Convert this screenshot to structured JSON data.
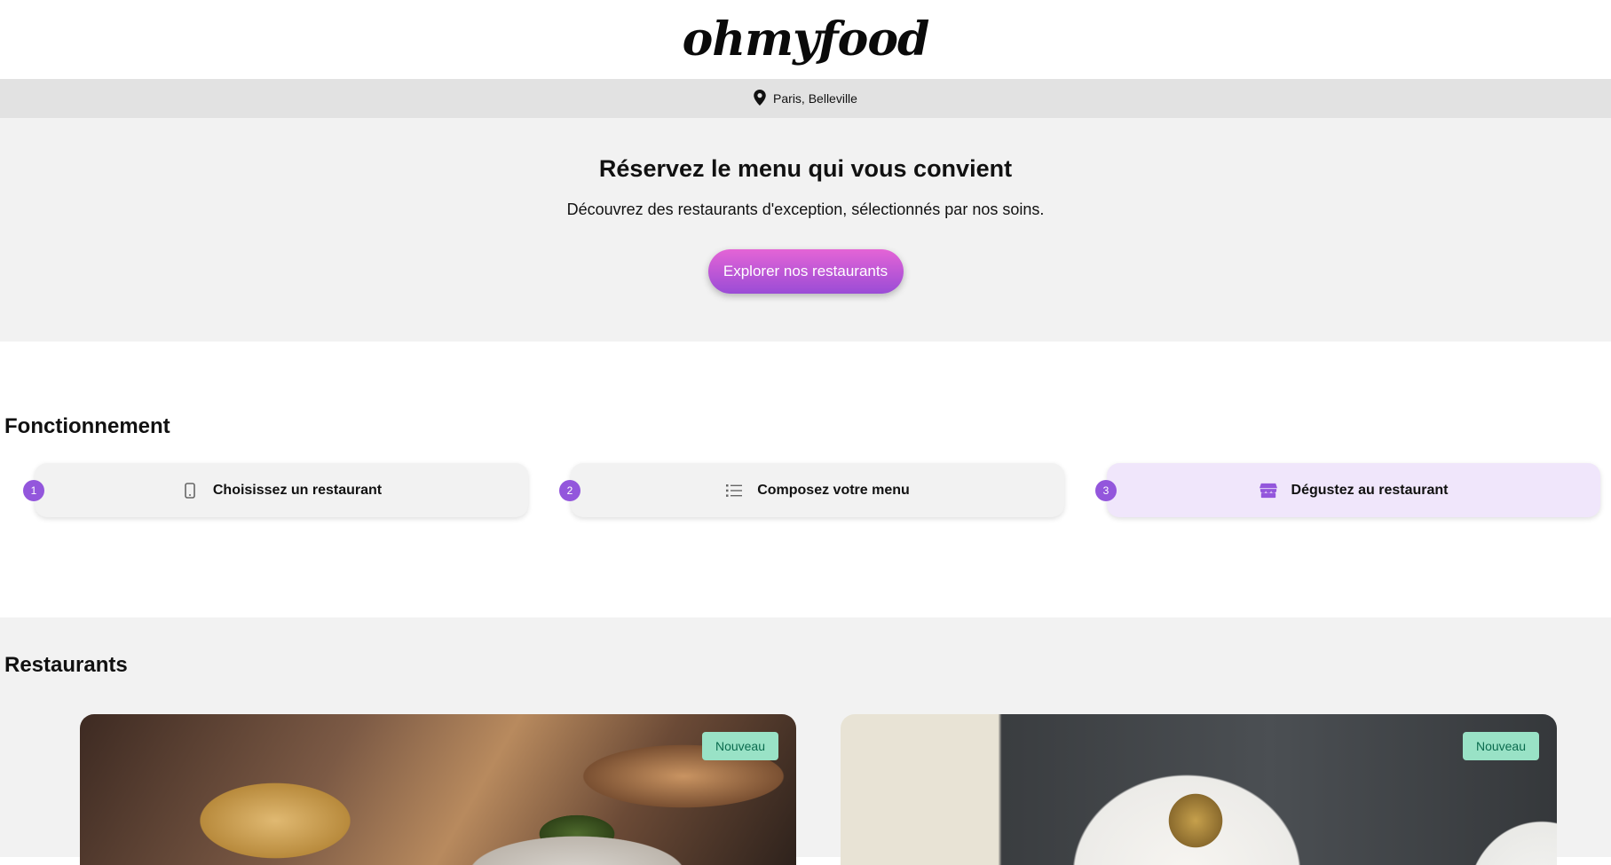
{
  "header": {
    "logo": "ohmyfood"
  },
  "location": {
    "icon": "map-pin-icon",
    "text": "Paris, Belleville"
  },
  "hero": {
    "title": "Réservez le menu qui vous convient",
    "subtitle": "Découvrez des restaurants d'exception, sélectionnés par nos soins.",
    "cta_label": "Explorer nos restaurants"
  },
  "how": {
    "title": "Fonctionnement",
    "steps": [
      {
        "num": "1",
        "label": "Choisissez un restaurant",
        "icon": "mobile-phone-icon"
      },
      {
        "num": "2",
        "label": "Composez votre menu",
        "icon": "list-icon"
      },
      {
        "num": "3",
        "label": "Dégustez au restaurant",
        "icon": "store-icon"
      }
    ]
  },
  "restaurants": {
    "title": "Restaurants",
    "cards": [
      {
        "badge": "Nouveau"
      },
      {
        "badge": "Nouveau"
      }
    ]
  },
  "colors": {
    "accent": "#9356dc",
    "badge_bg": "#99e2c6",
    "badge_text": "#0a6b4e"
  }
}
